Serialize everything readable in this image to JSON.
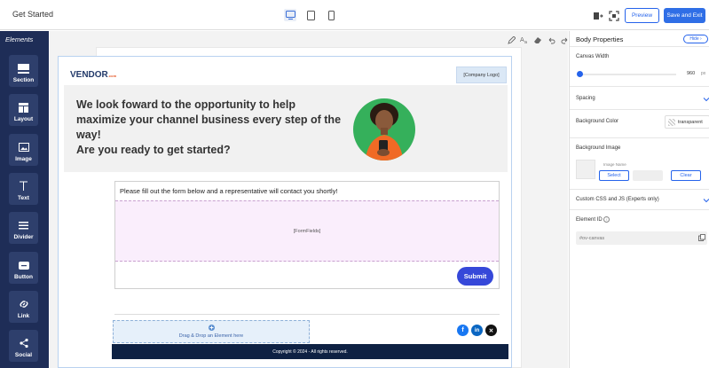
{
  "topbar": {
    "title": "Get Started",
    "preview_label": "Preview",
    "save_label": "Save and Exit"
  },
  "sidebar": {
    "heading": "Elements",
    "items": [
      {
        "label": "Section",
        "icon": "section-icon"
      },
      {
        "label": "Layout",
        "icon": "layout-icon"
      },
      {
        "label": "Image",
        "icon": "image-icon"
      },
      {
        "label": "Text",
        "icon": "text-icon"
      },
      {
        "label": "Divider",
        "icon": "divider-icon"
      },
      {
        "label": "Button",
        "icon": "button-icon"
      },
      {
        "label": "Link",
        "icon": "link-icon"
      },
      {
        "label": "Social",
        "icon": "social-icon"
      }
    ]
  },
  "email": {
    "vendor_logo": "VENDOR",
    "vendor_logo_suffix": ".com",
    "company_logo": "[Company Logo]",
    "hero_line1": "We look foward to the opportunity to help maximize your channel business every step of the way!",
    "hero_line2": "Are you ready to get started?",
    "form_intro": "Please fill out the form below and a representative will contact you shortly!",
    "form_fields": "[FormFields]",
    "submit_label": "Submit",
    "dropzone_text": "Drag & Drop an Element here",
    "footer_text": "Copyright © 2024 - All rights reserved."
  },
  "properties": {
    "title": "Body Properties",
    "hide_label": "Hide",
    "canvas_width_label": "Canvas Width",
    "canvas_width_value": "960",
    "canvas_width_unit": "px",
    "spacing_label": "Spacing",
    "bg_color_label": "Background Color",
    "bg_color_value": "transparent",
    "bg_image_label": "Background Image",
    "image_name_label": "Image Name",
    "select_label": "Select",
    "clear_label": "Clear",
    "custom_css_label": "Custom CSS and JS (Experts only)",
    "element_id_label": "Element ID",
    "element_id_placeholder": "#ov-canvas"
  },
  "colors": {
    "sidebar_bg": "#1e2d57",
    "accent": "#2563eb",
    "footer_bg": "#0e2143",
    "submit_bg": "#3648d9"
  }
}
